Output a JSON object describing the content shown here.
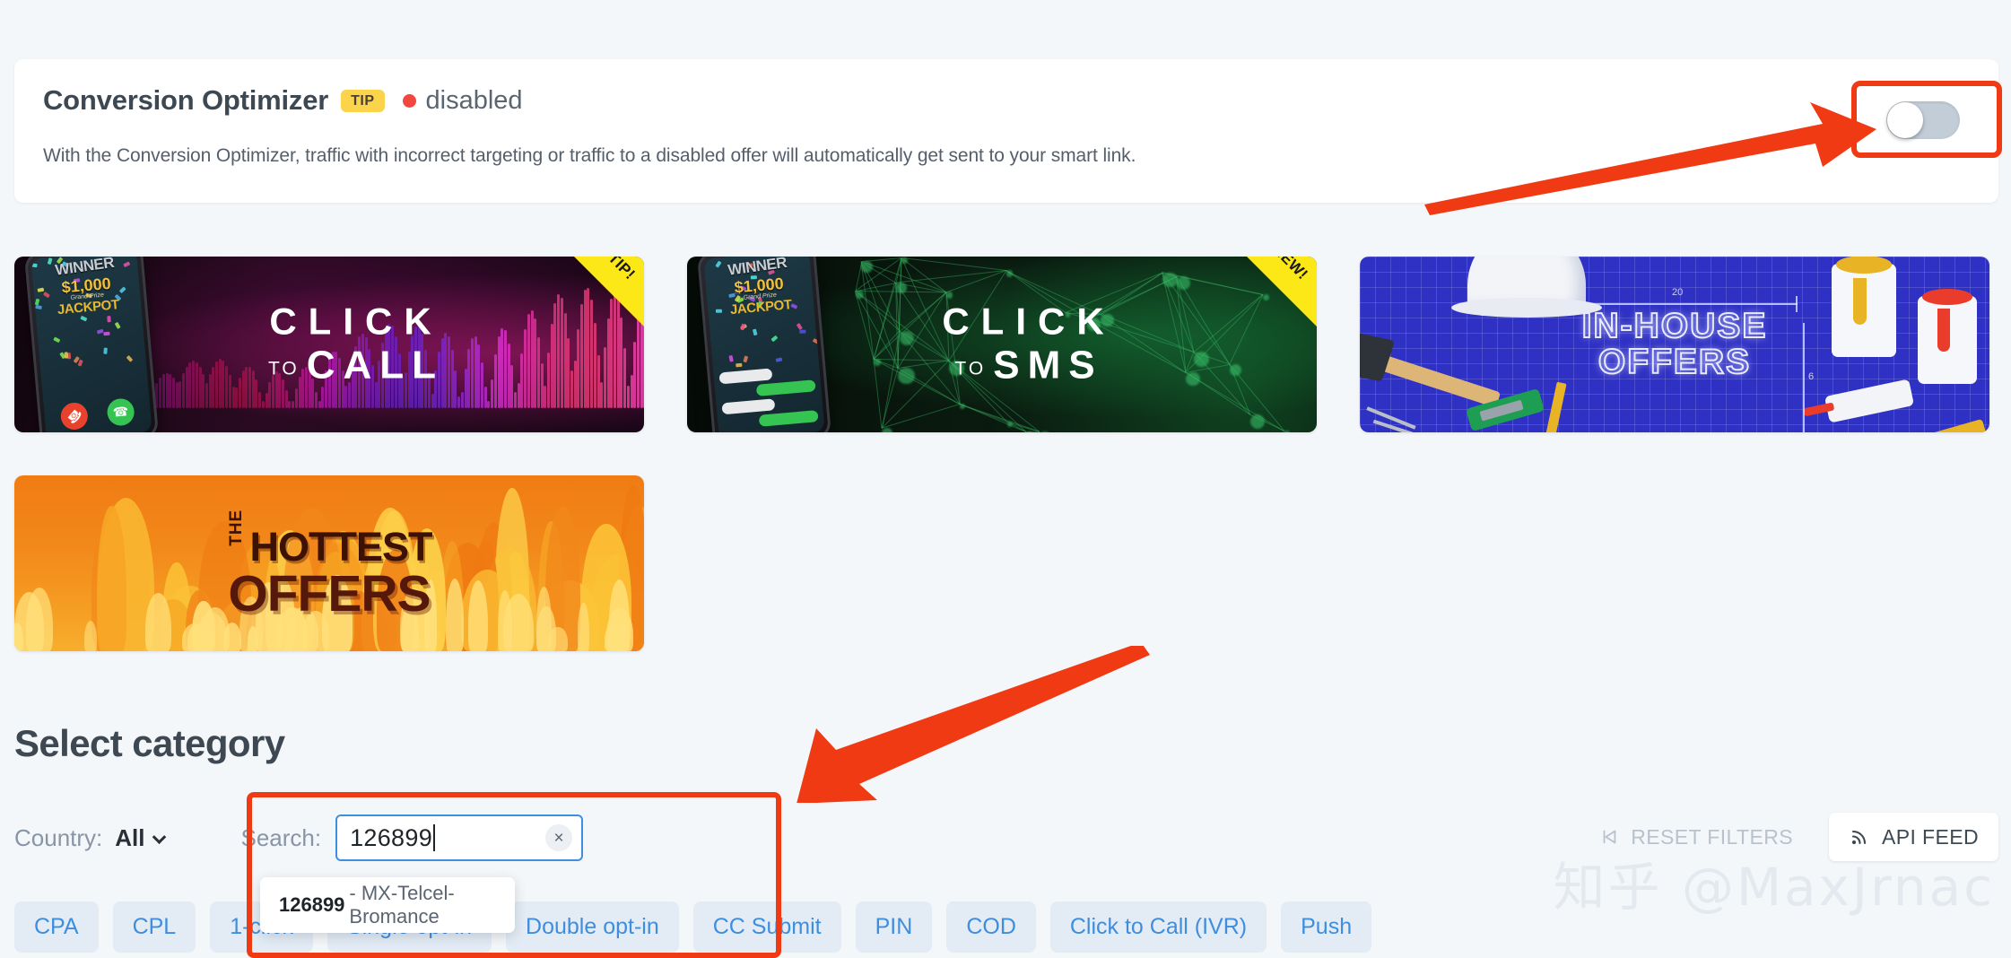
{
  "page": {
    "background": "#f4f7f9"
  },
  "conversion_optimizer": {
    "title": "Conversion Optimizer",
    "tip_badge": "TIP",
    "status": "disabled",
    "status_color": "#f0483e",
    "description": "With the Conversion Optimizer, traffic with incorrect targeting or traffic to a disabled offer will automatically get sent to your smart link.",
    "toggle_state": "off"
  },
  "banners": [
    {
      "id": "click-to-call",
      "line1": "CLICK",
      "to": "TO",
      "line2": "CALL",
      "ribbon": "TIP!",
      "phone_winner": "WINNER",
      "phone_amount": "$1,000",
      "phone_grand": "Grand Prize",
      "phone_jackpot": "JACKPOT"
    },
    {
      "id": "click-to-sms",
      "line1": "CLICK",
      "to": "TO",
      "line2": "SMS",
      "ribbon": "NEW!",
      "phone_winner": "WINNER",
      "phone_amount": "$1,000",
      "phone_grand": "Grand Prize",
      "phone_jackpot": "JACKPOT"
    },
    {
      "id": "in-house-offers",
      "line1": "IN-HOUSE",
      "line2": "OFFERS",
      "dim_w": "20",
      "dim_h": "6"
    },
    {
      "id": "hottest-offers",
      "the": "THE",
      "line1": "HOTTEST",
      "line2": "OFFERS"
    }
  ],
  "category_section": {
    "heading": "Select category",
    "country_label": "Country:",
    "country_value": "All",
    "search_label": "Search:",
    "search_value": "126899",
    "search_placeholder": "Search",
    "clear_icon": "×",
    "suggestion": {
      "code": "126899",
      "name": "- MX-Telcel-Bromance"
    },
    "reset_button": "RESET FILTERS",
    "api_button": "API FEED",
    "chips": [
      "CPA",
      "CPL",
      "1-click",
      "Single opt-in",
      "Double opt-in",
      "CC Submit",
      "PIN",
      "COD",
      "Click to Call (IVR)",
      "Push"
    ]
  },
  "annotations": {
    "color": "#f03a13",
    "toggle_arrow": "arrow-to-toggle",
    "search_arrow": "arrow-to-search"
  },
  "watermark": {
    "text": "知乎 @MaxJrnac"
  }
}
